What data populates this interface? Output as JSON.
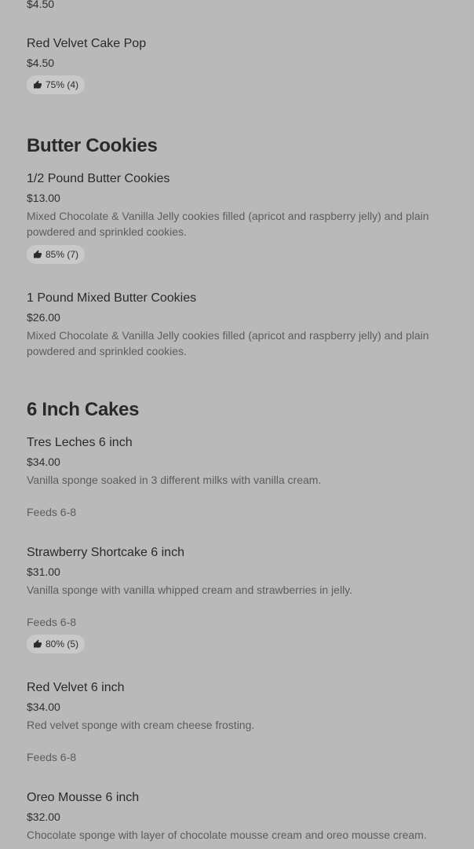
{
  "top_price": "$4.50",
  "items_top": [
    {
      "name": "Red Velvet Cake Pop",
      "price": "$4.50",
      "rating": "75% (4)"
    }
  ],
  "sections": [
    {
      "title": "Butter Cookies",
      "items": [
        {
          "name": "1/2 Pound Butter Cookies",
          "price": "$13.00",
          "description": "Mixed Chocolate & Vanilla Jelly cookies filled (apricot and raspberry jelly) and plain powdered and sprinkled cookies.",
          "rating": "85% (7)"
        },
        {
          "name": "1 Pound Mixed Butter Cookies",
          "price": "$26.00",
          "description": "Mixed Chocolate & Vanilla Jelly cookies filled (apricot and raspberry jelly) and plain powdered and sprinkled cookies."
        }
      ]
    },
    {
      "title": "6 Inch Cakes",
      "items": [
        {
          "name": "Tres Leches 6 inch",
          "price": "$34.00",
          "description": "Vanilla sponge soaked in 3 different milks with vanilla cream.",
          "feeds": "Feeds 6-8"
        },
        {
          "name": "Strawberry Shortcake 6 inch",
          "price": "$31.00",
          "description": "Vanilla sponge with vanilla whipped cream and strawberries in jelly.",
          "feeds": "Feeds 6-8",
          "rating": "80% (5)"
        },
        {
          "name": "Red Velvet 6 inch",
          "price": "$34.00",
          "description": "Red velvet sponge with cream cheese frosting.",
          "feeds": "Feeds 6-8"
        },
        {
          "name": "Oreo Mousse 6 inch",
          "price": "$32.00",
          "description": "Chocolate sponge with layer of chocolate mousse cream and oreo mousse cream."
        }
      ]
    }
  ],
  "icons": {
    "rating": "thumbs-up-icon"
  },
  "colors": {
    "background": "#b9b9b9",
    "badge": "#c9c9c9"
  }
}
